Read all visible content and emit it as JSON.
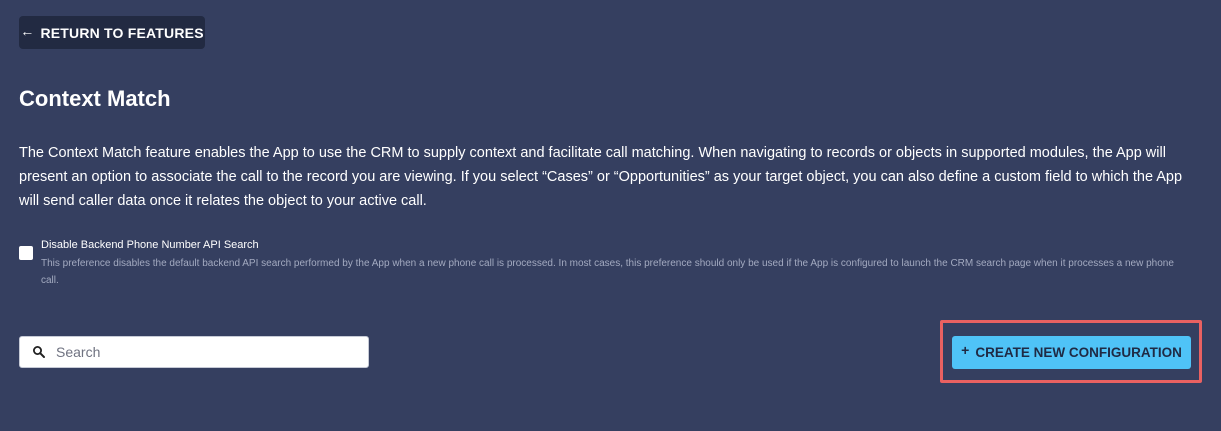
{
  "header": {
    "back_label": "RETURN TO FEATURES",
    "back_icon": "arrow-left-icon",
    "title": "Context Match"
  },
  "description": "The Context Match feature enables the App to use the CRM to supply context and facilitate call matching. When navigating to records or objects in supported modules, the App will present an option to associate the call to the record you are viewing. If you select “Cases” or “Opportunities” as your target object, you can also define a custom field to which the App will send caller data once it relates the object to your active call.",
  "preference": {
    "label": "Disable Backend Phone Number API Search",
    "help": "This preference disables the default backend API search performed by the App when a new phone call is processed. In most cases, this preference should only be used if the App is configured to launch the CRM search page when it processes a new phone call.",
    "checked": false
  },
  "search": {
    "placeholder": "Search",
    "value": "",
    "icon": "search-icon"
  },
  "actions": {
    "create_label": "CREATE NEW CONFIGURATION",
    "create_icon": "plus-icon",
    "highlight_color": "#e96161"
  },
  "colors": {
    "background": "#353f60",
    "back_button": "#222a42",
    "accent": "#4fc3f7"
  }
}
